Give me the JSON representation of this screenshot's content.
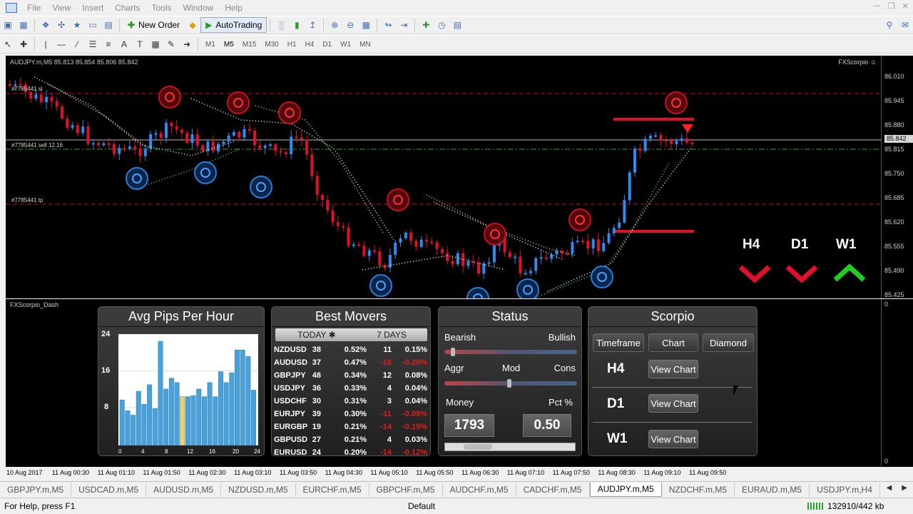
{
  "menu": [
    "File",
    "View",
    "Insert",
    "Charts",
    "Tools",
    "Window",
    "Help"
  ],
  "toolbar": {
    "new_order": "New Order",
    "autotrading": "AutoTrading"
  },
  "timeframes": [
    "M1",
    "M5",
    "M15",
    "M30",
    "H1",
    "H4",
    "D1",
    "W1",
    "MN"
  ],
  "active_timeframe": "M5",
  "chart": {
    "title": "AUDJPY.m,M5  85.813 85.854 85.806 85.842",
    "brand": "FXScorpio ☺",
    "levels": {
      "sl": "#7785441 sl",
      "sell": "#7785441 sell 12.16",
      "tp": "#7785441 tp"
    },
    "price_labels": [
      "86.010",
      "85.945",
      "85.880",
      "85.815",
      "85.750",
      "85.685",
      "85.620",
      "85.555",
      "85.490",
      "85.425"
    ],
    "current_price": "85.842",
    "badges": [
      {
        "tf": "H4",
        "dir": "down"
      },
      {
        "tf": "D1",
        "dir": "down"
      },
      {
        "tf": "W1",
        "dir": "up"
      }
    ],
    "colors": {
      "up": "#2e8cf0",
      "down": "#e0102a",
      "green": "#22cc22"
    }
  },
  "dash": {
    "title": "FXScorpio_Dash",
    "axis_top": "0",
    "axis_bottom": "0",
    "avg_pips": {
      "title": "Avg Pips Per Hour",
      "y_ticks": [
        "24",
        "16",
        "8"
      ],
      "x_ticks": [
        "0",
        "4",
        "8",
        "12",
        "16",
        "20",
        "24"
      ]
    },
    "best_movers": {
      "title": "Best Movers",
      "tab_today": "TODAY ✱",
      "tab_days": "7 DAYS",
      "rows": [
        {
          "pair": "NZDUSD",
          "pips": "38",
          "pct": "0.52%",
          "wpips": "11",
          "wpct": "0.15%",
          "neg": false
        },
        {
          "pair": "AUDUSD",
          "pips": "37",
          "pct": "0.47%",
          "wpips": "-16",
          "wpct": "-0.20%",
          "neg": true
        },
        {
          "pair": "GBPJPY",
          "pips": "48",
          "pct": "0.34%",
          "wpips": "12",
          "wpct": "0.08%",
          "neg": false
        },
        {
          "pair": "USDJPY",
          "pips": "36",
          "pct": "0.33%",
          "wpips": "4",
          "wpct": "0.04%",
          "neg": false
        },
        {
          "pair": "USDCHF",
          "pips": "30",
          "pct": "0.31%",
          "wpips": "3",
          "wpct": "0.04%",
          "neg": false
        },
        {
          "pair": "EURJPY",
          "pips": "39",
          "pct": "0.30%",
          "wpips": "-11",
          "wpct": "-0.09%",
          "neg": true
        },
        {
          "pair": "EURGBP",
          "pips": "19",
          "pct": "0.21%",
          "wpips": "-14",
          "wpct": "-0.15%",
          "neg": true
        },
        {
          "pair": "GBPUSD",
          "pips": "27",
          "pct": "0.21%",
          "wpips": "4",
          "wpct": "0.03%",
          "neg": false
        },
        {
          "pair": "EURUSD",
          "pips": "24",
          "pct": "0.20%",
          "wpips": "-14",
          "wpct": "-0.12%",
          "neg": true
        }
      ]
    },
    "status": {
      "title": "Status",
      "bearish": "Bearish",
      "bullish": "Bullish",
      "aggr": "Aggr",
      "mod": "Mod",
      "cons": "Cons",
      "money_label": "Money",
      "pct_label": "Pct %",
      "money": "1793",
      "pct": "0.50"
    },
    "scorpio": {
      "title": "Scorpio",
      "btn_timeframe": "Timeframe",
      "btn_chart": "Chart",
      "btn_diamond": "Diamond",
      "rows": [
        {
          "tf": "H4",
          "btn": "View Chart"
        },
        {
          "tf": "D1",
          "btn": "View Chart"
        },
        {
          "tf": "W1",
          "btn": "View Chart"
        }
      ]
    }
  },
  "time_axis": [
    "10 Aug 2017",
    "11 Aug 00:30",
    "11 Aug 01:10",
    "11 Aug 01:50",
    "11 Aug 02:30",
    "11 Aug 03:10",
    "11 Aug 03:50",
    "11 Aug 04:30",
    "11 Aug 05:10",
    "11 Aug 05:50",
    "11 Aug 06:30",
    "11 Aug 07:10",
    "11 Aug 07:50",
    "11 Aug 08:30",
    "11 Aug 09:10",
    "11 Aug 09:50"
  ],
  "tabs": [
    "GBPJPY.m,M5",
    "USDCAD.m,M5",
    "AUDUSD.m,M5",
    "NZDUSD.m,M5",
    "EURCHF.m,M5",
    "GBPCHF.m,M5",
    "AUDCHF.m,M5",
    "CADCHF.m,M5",
    "AUDJPY.m,M5",
    "NZDCHF.m,M5",
    "EURAUD.m,M5",
    "USDJPY.m,H4"
  ],
  "active_tab": "AUDJPY.m,M5",
  "statusbar": {
    "help": "For Help, press F1",
    "profile": "Default",
    "traffic": "132910/442 kb"
  }
}
